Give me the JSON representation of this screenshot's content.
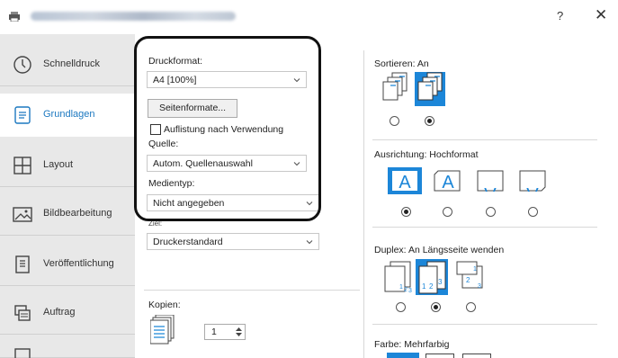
{
  "titlebar": {
    "help_label": "?",
    "close_label": "✕"
  },
  "sidebar": {
    "items": [
      {
        "label": "Schnelldruck",
        "icon": "clock-icon"
      },
      {
        "label": "Grundlagen",
        "icon": "document-icon"
      },
      {
        "label": "Layout",
        "icon": "layout-grid-icon"
      },
      {
        "label": "Bildbearbeitung",
        "icon": "image-icon"
      },
      {
        "label": "Veröffentlichung",
        "icon": "book-icon"
      },
      {
        "label": "Auftrag",
        "icon": "job-icon"
      }
    ]
  },
  "basics": {
    "paper_size_label": "Druckformat:",
    "paper_size_value": "A4 [100%]",
    "page_sizes_button": "Seitenformate...",
    "list_by_usage_label": "Auflistung nach Verwendung",
    "source_label": "Quelle:",
    "source_value": "Autom. Quellenauswahl",
    "media_type_label": "Medientyp:",
    "media_type_value": "Nicht angegeben",
    "destination_label": "Ziel:",
    "destination_value": "Druckerstandard",
    "copies_label": "Kopien:",
    "copies_value": "1"
  },
  "options": {
    "collate_label": "Sortieren: An",
    "orientation_label": "Ausrichtung: Hochformat",
    "duplex_label": "Duplex: An Längsseite wenden",
    "color_label": "Farbe: Mehrfarbig"
  },
  "colors": {
    "accent": "#1c86d8",
    "active_nav": "#1c78c0"
  }
}
